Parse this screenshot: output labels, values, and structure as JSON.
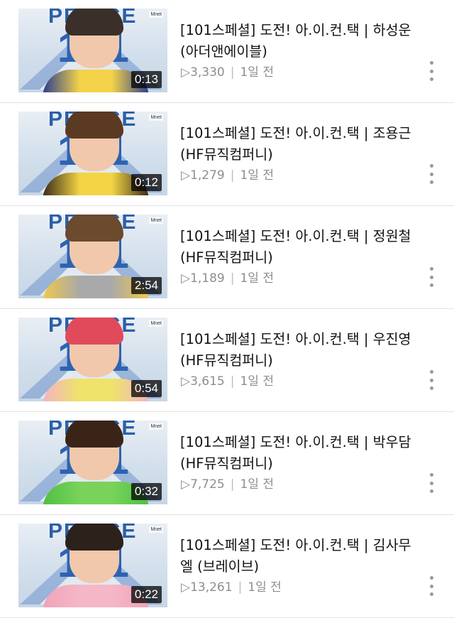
{
  "videos": [
    {
      "title_line1": "[101스페셜] 도전! 아.이.컨.택 | 하성운",
      "title_line2": "(아더앤에이블)",
      "play_icon": "▷",
      "views": "3,330",
      "time": "1일 전",
      "duration": "0:13",
      "hair_color": "#3b2f2a",
      "shirt_color": "#f4d24a",
      "shirt_color2": "#2a3d8f"
    },
    {
      "title_line1": "[101스페셜] 도전! 아.이.컨.택 | 조용근",
      "title_line2": "(HF뮤직컴퍼니)",
      "play_icon": "▷",
      "views": "1,279",
      "time": "1일 전",
      "duration": "0:12",
      "hair_color": "#5a3a22",
      "shirt_color": "#f3d544",
      "shirt_color2": "#3a2a1a"
    },
    {
      "title_line1": "[101스페셜] 도전! 아.이.컨.택 | 정원철",
      "title_line2": "(HF뮤직컴퍼니)",
      "play_icon": "▷",
      "views": "1,189",
      "time": "1일 전",
      "duration": "2:54",
      "hair_color": "#6b4a2e",
      "shirt_color": "#a9a9a9",
      "shirt_color2": "#f0c94a"
    },
    {
      "title_line1": "[101스페셜] 도전! 아.이.컨.택 | 우진영",
      "title_line2": "(HF뮤직컴퍼니)",
      "play_icon": "▷",
      "views": "3,615",
      "time": "1일 전",
      "duration": "0:54",
      "hair_color": "#e04a5a",
      "shirt_color": "#efe36a",
      "shirt_color2": "#f2b3c4"
    },
    {
      "title_line1": "[101스페셜] 도전! 아.이.컨.택 | 박우담",
      "title_line2": "(HF뮤직컴퍼니)",
      "play_icon": "▷",
      "views": "7,725",
      "time": "1일 전",
      "duration": "0:32",
      "hair_color": "#3a2418",
      "shirt_color": "#79d35a",
      "shirt_color2": "#4fbf44"
    },
    {
      "title_line1": "[101스페셜] 도전! 아.이.컨.택 | 김사무",
      "title_line2": "엘 (브레이브)",
      "play_icon": "▷",
      "views": "13,261",
      "time": "1일 전",
      "duration": "0:22",
      "hair_color": "#2c211b",
      "shirt_color": "#f5b7c8",
      "shirt_color2": "#f0a3b9"
    }
  ],
  "thumb_text": {
    "prince": "PRINCE",
    "number": "101",
    "logo": "Mnet"
  },
  "colors": {
    "title": "#111111",
    "meta": "#8e8e8e",
    "duration_bg": "#000000bf",
    "divider": "#e3e3e3",
    "dots": "#9a9a9a"
  }
}
